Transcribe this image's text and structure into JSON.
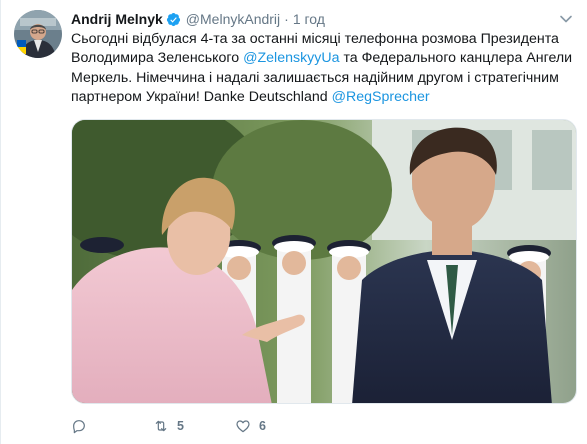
{
  "user": {
    "display_name": "Andrij Melnyk",
    "handle": "@MelnykAndrij",
    "separator": "·",
    "time": "1 год",
    "avatar_icon": "avatar-portrait",
    "verified_icon": "verified-badge-icon"
  },
  "tweet": {
    "line1": "Сьогодні відбулася 4-та за останні місяці телефонна розмова Президента",
    "line2_pre": "Володимира Зеленського ",
    "line2_mention": "@ZelenskyyUa",
    "line2_post": " та Федерального канцлера Ангели",
    "line3": "Меркель. Німеччина і надалі залишається надійним другом і стратегічним",
    "line4_pre": "партнером України! Danke Deutschland ",
    "line4_mention": "@RegSprecher"
  },
  "media": {
    "description_icon": "photo"
  },
  "actions": {
    "reply_count": "",
    "retweet_count": "5",
    "like_count": "6"
  },
  "colors": {
    "link": "#1b95e0",
    "verified": "#1da1f2",
    "muted": "#657786"
  }
}
